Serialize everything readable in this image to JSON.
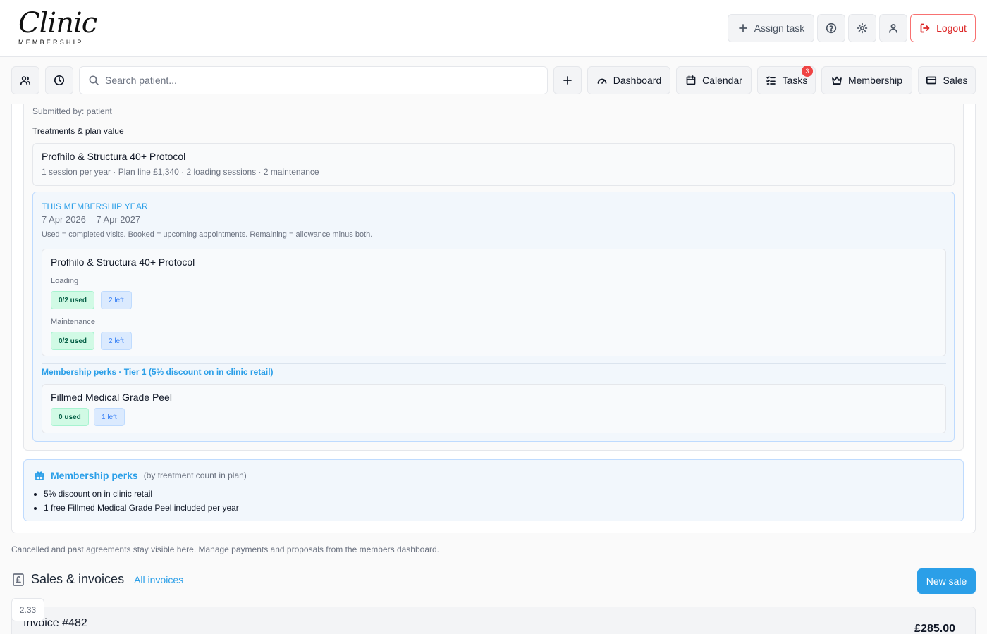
{
  "brand": {
    "logo_script": "Clinic",
    "logo_sub": "MEMBERSHIP"
  },
  "header": {
    "assign_task": "Assign task",
    "logout": "Logout",
    "icons": [
      "help-icon",
      "gear-icon",
      "user-icon",
      "logout-icon",
      "plus-icon"
    ]
  },
  "nav": {
    "search_placeholder": "Search patient...",
    "dashboard": "Dashboard",
    "calendar": "Calendar",
    "tasks": "Tasks",
    "tasks_badge": "3",
    "membership": "Membership",
    "sales": "Sales"
  },
  "agreement": {
    "submitted_by": "Submitted by: patient",
    "treatments_label": "Treatments & plan value",
    "plan": {
      "name": "Profhilo & Structura 40+ Protocol",
      "meta": "1 session per year · Plan line £1,340 · 2 loading sessions · 2 maintenance"
    },
    "year": {
      "title": "This membership year",
      "range": "7 Apr 2026 – 7 Apr 2027",
      "note": "Used = completed visits. Booked = upcoming appointments. Remaining = allowance minus both.",
      "treatment": {
        "name": "Profhilo & Structura 40+ Protocol",
        "phases": [
          {
            "label": "Loading",
            "used": "0/2 used",
            "left": "2 left"
          },
          {
            "label": "Maintenance",
            "used": "0/2 used",
            "left": "2 left"
          }
        ]
      },
      "perks_line": "Membership perks · Tier 1 (5% discount on in clinic retail)",
      "perk_item": {
        "name": "Fillmed Medical Grade Peel",
        "used": "0 used",
        "left": "1 left"
      }
    }
  },
  "perks_box": {
    "title": "Membership perks",
    "subtitle": "(by treatment count in plan)",
    "items": [
      "5% discount on in clinic retail",
      "1 free Fillmed Medical Grade Peel included per year"
    ]
  },
  "footer_note": "Cancelled and past agreements stay visible here. Manage payments and proposals from the members dashboard.",
  "sales_section": {
    "title": "Sales & invoices",
    "all_invoices": "All invoices",
    "new_sale": "New sale",
    "invoice": {
      "number": "Invoice #482",
      "total": "£285.00"
    },
    "zoom_chip": "2.33"
  },
  "colors": {
    "accent": "#2b9fe8",
    "danger": "#dc2626",
    "used_bg": "#d1fae5",
    "left_bg": "#dbeafe"
  }
}
